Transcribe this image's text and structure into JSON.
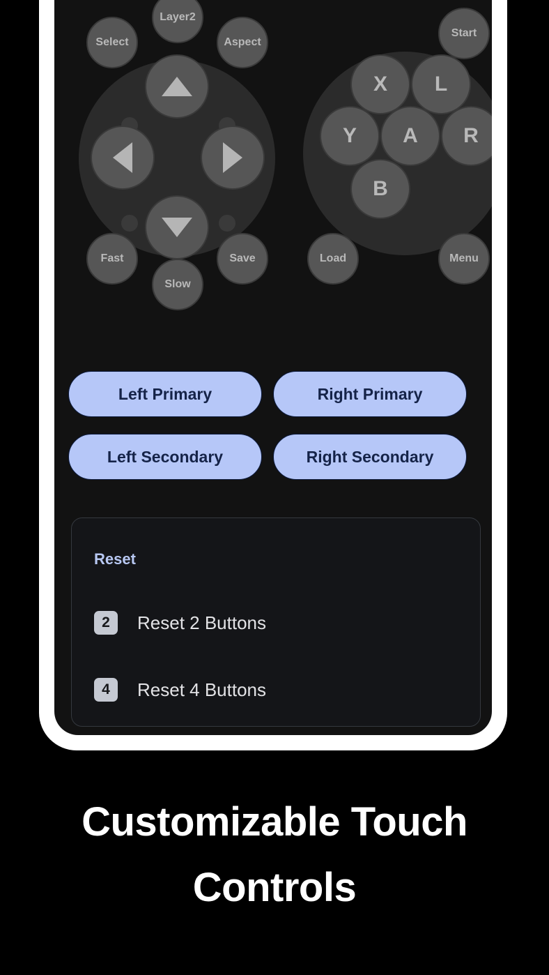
{
  "colors": {
    "page_background": "#000000",
    "phone_frame": "#ffffff",
    "screen_background": "#121212",
    "button_fill": "#565656",
    "button_label": "#b9b9b9",
    "dpad_base": "#2b2b2b",
    "pill_fill": "#b6c7f8",
    "pill_text": "#152348",
    "reset_title": "#b8c8f2",
    "caption_text": "#ffffff"
  },
  "controller": {
    "left_cluster": {
      "top_buttons": [
        {
          "label": "Select",
          "name": "select-button"
        },
        {
          "label": "Layer2",
          "name": "layer2-button"
        },
        {
          "label": "Aspect",
          "name": "aspect-button"
        }
      ],
      "dpad": [
        {
          "label": "▲",
          "name": "dpad-up-button",
          "direction": "up"
        },
        {
          "label": "▼",
          "name": "dpad-down-button",
          "direction": "down"
        },
        {
          "label": "◀",
          "name": "dpad-left-button",
          "direction": "left"
        },
        {
          "label": "▶",
          "name": "dpad-right-button",
          "direction": "right"
        }
      ],
      "bottom_buttons": [
        {
          "label": "Fast",
          "name": "fast-button"
        },
        {
          "label": "Slow",
          "name": "slow-button"
        },
        {
          "label": "Save",
          "name": "save-button"
        }
      ]
    },
    "right_cluster": {
      "top_buttons": [
        {
          "label": "Start",
          "name": "start-button"
        }
      ],
      "face_buttons": [
        {
          "label": "X",
          "name": "x-button"
        },
        {
          "label": "L",
          "name": "l-button"
        },
        {
          "label": "Y",
          "name": "y-button"
        },
        {
          "label": "A",
          "name": "a-button"
        },
        {
          "label": "R",
          "name": "r-button"
        },
        {
          "label": "B",
          "name": "b-button"
        }
      ],
      "bottom_buttons": [
        {
          "label": "Load",
          "name": "load-button"
        },
        {
          "label": "Menu",
          "name": "menu-button"
        }
      ]
    }
  },
  "pill_buttons": [
    {
      "label": "Left Primary",
      "name": "left-primary-button"
    },
    {
      "label": "Right Primary",
      "name": "right-primary-button"
    },
    {
      "label": "Left Secondary",
      "name": "left-secondary-button"
    },
    {
      "label": "Right Secondary",
      "name": "right-secondary-button"
    }
  ],
  "reset_section": {
    "title": "Reset",
    "items": [
      {
        "badge": "2",
        "label": "Reset 2 Buttons"
      },
      {
        "badge": "4",
        "label": "Reset 4 Buttons"
      }
    ]
  },
  "caption": {
    "line1": "Customizable Touch",
    "line2": "Controls"
  }
}
